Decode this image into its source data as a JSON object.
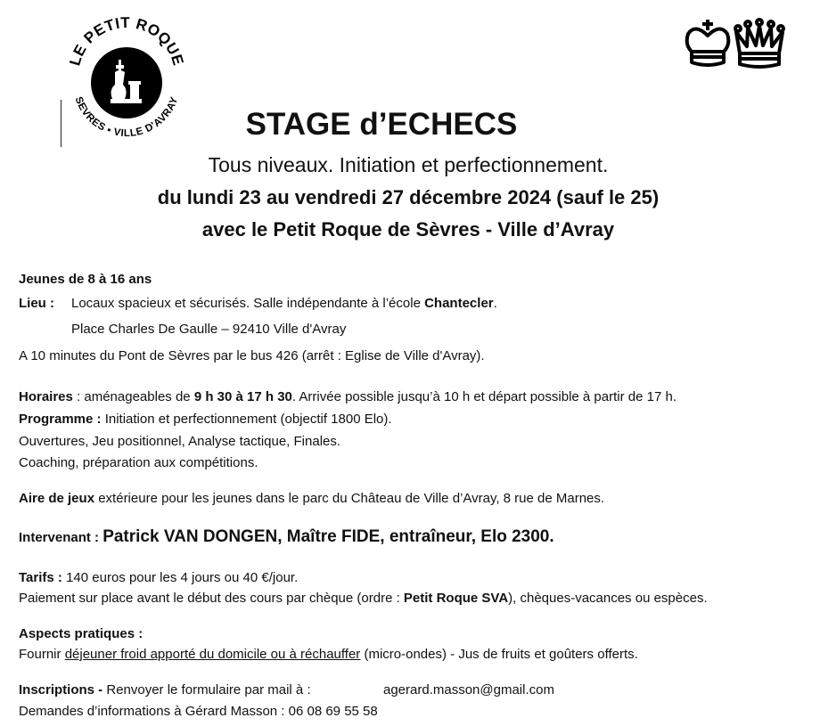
{
  "logo": {
    "top_text": "LE PETIT ROQUE",
    "bottom_text": "SEVRES ▪ VILLE D'AVRAY"
  },
  "header": {
    "title": "STAGE d’ECHECS",
    "subtitle": "Tous niveaux. Initiation et perfectionnement.",
    "dates": "du lundi 23 au vendredi 27 décembre 2024 (sauf le 25)",
    "club": "avec le Petit Roque de Sèvres - Ville d’Avray"
  },
  "body": {
    "jeunes": "Jeunes de 8 à 16 ans",
    "lieu": {
      "label": "Lieu :",
      "text": "Locaux spacieux et sécurisés. Salle indépendante à l’école ",
      "school": "Chantecler",
      "end": ".",
      "address": "Place Charles De Gaulle – 92410 Ville d'Avray",
      "access": "A 10 minutes du Pont de Sèvres par le bus 426 (arrêt : Eglise de Ville d'Avray)."
    },
    "horaires": {
      "label": "Horaires",
      "pre": " : aménageables de ",
      "hours": "9 h 30 à 17 h 30",
      "post": ". Arrivée possible jusqu’à 10 h et départ possible à partir de 17 h."
    },
    "programme": {
      "label": "Programme :",
      "text": " Initiation et perfectionnement (objectif 1800 Elo).",
      "line2": "Ouvertures, Jeu positionnel, Analyse tactique, Finales.",
      "line3": "Coaching, préparation aux compétitions."
    },
    "aire": {
      "label": "Aire de jeux",
      "text": " extérieure pour les jeunes dans le parc du Château de Ville d’Avray, 8 rue de Marnes."
    },
    "intervenant": {
      "label": "Intervenant : ",
      "name": "Patrick VAN DONGEN, Maître FIDE, entraîneur, Elo 2300."
    },
    "tarifs": {
      "label": "Tarifs :",
      "text": " 140 euros pour les 4 jours ou 40 €/jour.",
      "pay_pre": "Paiement sur place avant le début des cours par chèque (ordre : ",
      "pay_bold": "Petit Roque SVA",
      "pay_post": "), chèques-vacances ou espèces."
    },
    "aspects": {
      "label": "Aspects pratiques :",
      "pre": "Fournir ",
      "underlined": "déjeuner froid apporté du domicile ou à réchauffer",
      "post": " (micro-ondes) - Jus de fruits et goûters offerts."
    },
    "inscriptions": {
      "label": "Inscriptions -",
      "text": " Renvoyer le formulaire par mail à :",
      "email": "agerard.masson@gmail.com",
      "contact": "Demandes d’informations à Gérard Masson : 06 08 69 55 58"
    }
  }
}
